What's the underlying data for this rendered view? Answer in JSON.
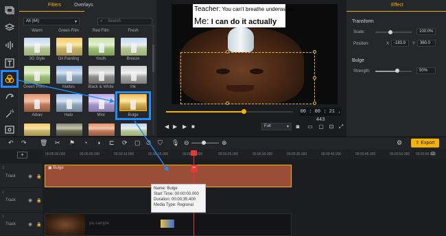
{
  "panel": {
    "tabs": [
      "Filters",
      "Overlays"
    ],
    "category": "All (64)",
    "search_placeholder": "Search",
    "filters": [
      {
        "label": "Warm"
      },
      {
        "label": "Green Film"
      },
      {
        "label": "Red Film"
      },
      {
        "label": "Fresh"
      },
      {
        "label": "3G Style"
      },
      {
        "label": "Oil Painting"
      },
      {
        "label": "Youth"
      },
      {
        "label": "Breeze"
      },
      {
        "label": "Green Porc..."
      },
      {
        "label": "Mattes"
      },
      {
        "label": "Black & White"
      },
      {
        "label": "Ink"
      },
      {
        "label": "Aibao"
      },
      {
        "label": "Halo"
      },
      {
        "label": "Mist"
      },
      {
        "label": "Bulge"
      }
    ]
  },
  "preview": {
    "meme_line1_prefix": "Teacher:",
    "meme_line1_rest": " You can't breathe underwater.",
    "meme_line2_prefix": "Me:",
    "meme_line2_rest": " I can do it actually",
    "timecode": "00 : 00 : 21 . 443",
    "quality": "Full",
    "progress": 0.61
  },
  "effect_panel": {
    "tab": "Effect",
    "transform_title": "Transform",
    "scale_label": "Scale:",
    "scale_value": "100.0%",
    "position_label": "Position:",
    "pos_x_label": "X",
    "pos_x": "-183.9",
    "pos_y_label": "Y",
    "pos_y": "360.0",
    "bulge_title": "Bulge",
    "strength_label": "Strength:",
    "strength_value": "50%"
  },
  "toolbar": {
    "export_label": "Export"
  },
  "timeline": {
    "ticks": [
      "00:00:00.000",
      "00:00:05.000",
      "00:00:10.000",
      "00:00:15.000",
      "00:00:20.000",
      "00:00:25.000",
      "00:00:30.000",
      "00:00:35.000",
      "00:00:40.000",
      "00:00:45.000",
      "00:00:50.000",
      "00:00:55.000"
    ],
    "tracks": [
      {
        "num": "3",
        "name": "Track"
      },
      {
        "num": "2",
        "name": "Track"
      },
      {
        "num": "1",
        "name": "Track"
      }
    ],
    "effect_clip_label": "Bulge",
    "video_clip_label": "pic-sample"
  },
  "tooltip": {
    "name": "Name: Bulge",
    "start": "Start Time: 00:00:00.000",
    "duration": "Duration: 00:00:35.400",
    "media_type": "Media Type: Regional"
  },
  "colors": {
    "accent": "#f5b400",
    "highlight": "#1f8bff",
    "clip": "#9a4e38",
    "playhead": "#e53935"
  }
}
